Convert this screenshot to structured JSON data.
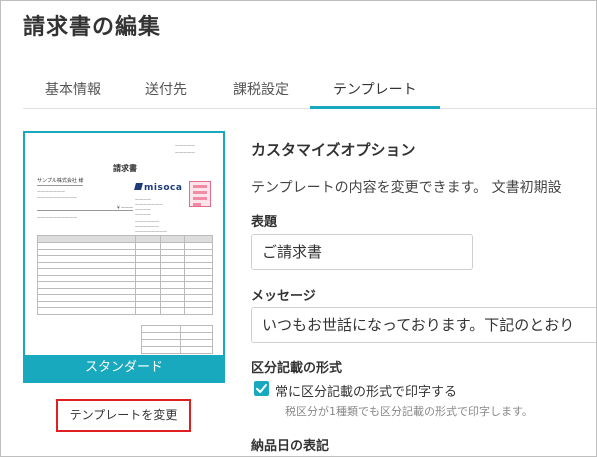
{
  "page_title": "請求書の編集",
  "tabs": [
    {
      "label": "基本情報"
    },
    {
      "label": "送付先"
    },
    {
      "label": "課税設定"
    },
    {
      "label": "テンプレート",
      "active": true
    }
  ],
  "template": {
    "name": "スタンダード",
    "change_button": "テンプレートを変更",
    "preview": {
      "doc_title": "請求書",
      "customer": "サンプル株式会社 様",
      "logo_text": "misoca"
    }
  },
  "customize": {
    "title": "カスタマイズオプション",
    "description": "テンプレートの内容を変更できます。 文書初期設",
    "subject_label": "表題",
    "subject_value": "ご請求書",
    "message_label": "メッセージ",
    "message_value": "いつもお世話になっております。下記のとおり",
    "tax_label": "区分記載の形式",
    "tax_checkbox_label": "常に区分記載の形式で印字する",
    "tax_checkbox_checked": true,
    "tax_note": "税区分が1種類でも区分記載の形式で印字します。",
    "delivery_label": "納品日の表記"
  },
  "colors": {
    "accent": "#19a9be",
    "highlight_border": "#e02020"
  }
}
